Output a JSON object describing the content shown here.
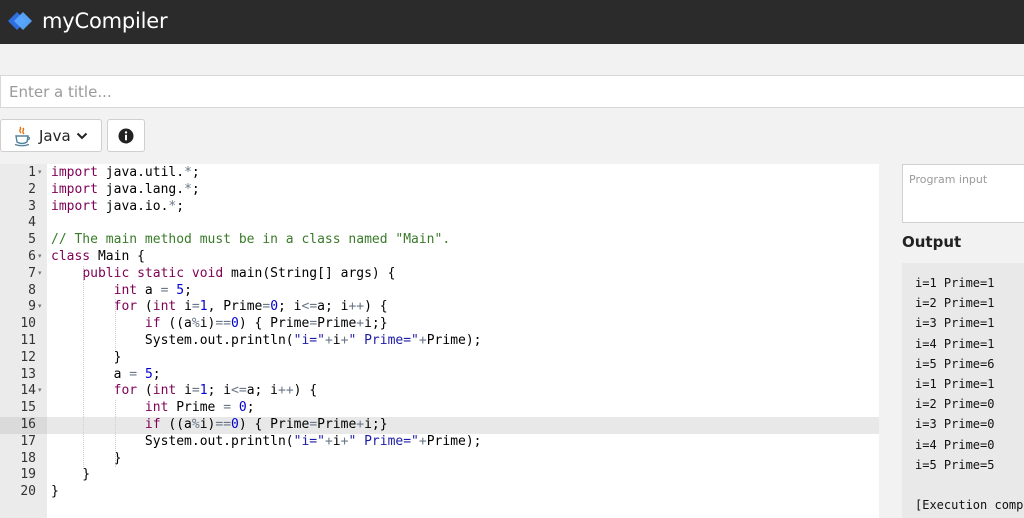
{
  "app": {
    "name": "myCompiler",
    "brand_colors": [
      "#3d7ef2",
      "#5aa8ff"
    ]
  },
  "title_input": {
    "placeholder": "Enter a title...",
    "value": ""
  },
  "language": {
    "selected": "Java",
    "icon": "java-icon"
  },
  "info_button": {
    "icon": "info-icon"
  },
  "editor": {
    "active_line": 16,
    "lines": [
      {
        "n": "1",
        "fold": true,
        "code": "<span class=\"k\">import</span> java.util.<span class=\"o\">*</span>;"
      },
      {
        "n": "2",
        "fold": false,
        "code": "<span class=\"k\">import</span> java.lang.<span class=\"o\">*</span>;"
      },
      {
        "n": "3",
        "fold": false,
        "code": "<span class=\"k\">import</span> java.io.<span class=\"o\">*</span>;"
      },
      {
        "n": "4",
        "fold": false,
        "code": ""
      },
      {
        "n": "5",
        "fold": false,
        "code": "<span class=\"c\">// The main method must be in a class named \"Main\".</span>"
      },
      {
        "n": "6",
        "fold": true,
        "code": "<span class=\"k\">class</span> Main {"
      },
      {
        "n": "7",
        "fold": true,
        "code": "    <span class=\"k\">public</span> <span class=\"k\">static</span> <span class=\"k\">void</span> main(String[] args) {"
      },
      {
        "n": "8",
        "fold": false,
        "code": "        <span class=\"t\">int</span> a <span class=\"o\">=</span> <span class=\"n\">5</span>;"
      },
      {
        "n": "9",
        "fold": true,
        "code": "        <span class=\"k\">for</span> (<span class=\"t\">int</span> i<span class=\"o\">=</span><span class=\"n\">1</span>, Prime<span class=\"o\">=</span><span class=\"n\">0</span>; i<span class=\"o\">&lt;=</span>a; i<span class=\"o\">++</span>) {"
      },
      {
        "n": "10",
        "fold": false,
        "code": "            <span class=\"k\">if</span> ((a<span class=\"o\">%</span>i)<span class=\"o\">==</span><span class=\"n\">0</span>) { Prime<span class=\"o\">=</span>Prime<span class=\"o\">+</span>i;}"
      },
      {
        "n": "11",
        "fold": false,
        "code": "            System.out.println(<span class=\"s\">\"i=\"</span><span class=\"o\">+</span>i<span class=\"o\">+</span><span class=\"s\">\" Prime=\"</span><span class=\"o\">+</span>Prime);"
      },
      {
        "n": "12",
        "fold": false,
        "code": "        }"
      },
      {
        "n": "13",
        "fold": false,
        "code": "        a <span class=\"o\">=</span> <span class=\"n\">5</span>;"
      },
      {
        "n": "14",
        "fold": true,
        "code": "        <span class=\"k\">for</span> (<span class=\"t\">int</span> i<span class=\"o\">=</span><span class=\"n\">1</span>; i<span class=\"o\">&lt;=</span>a; i<span class=\"o\">++</span>) {"
      },
      {
        "n": "15",
        "fold": false,
        "code": "            <span class=\"t\">int</span> Prime <span class=\"o\">=</span> <span class=\"n\">0</span>;"
      },
      {
        "n": "16",
        "fold": false,
        "code": "            <span class=\"k\">if</span> ((a<span class=\"o\">%</span>i)<span class=\"o\">==</span><span class=\"n\">0</span>) { Prime<span class=\"o\">=</span>Prime<span class=\"o\">+</span>i;}"
      },
      {
        "n": "17",
        "fold": false,
        "code": "            System.out.println(<span class=\"s\">\"i=\"</span><span class=\"o\">+</span>i<span class=\"o\">+</span><span class=\"s\">\" Prime=\"</span><span class=\"o\">+</span>Prime);"
      },
      {
        "n": "18",
        "fold": false,
        "code": "        }"
      },
      {
        "n": "19",
        "fold": false,
        "code": "    }"
      },
      {
        "n": "20",
        "fold": false,
        "code": "}"
      }
    ]
  },
  "program_input": {
    "placeholder": "Program input",
    "value": ""
  },
  "output": {
    "label": "Output",
    "lines": [
      "i=1 Prime=1",
      "i=2 Prime=1",
      "i=3 Prime=1",
      "i=4 Prime=1",
      "i=5 Prime=6",
      "i=1 Prime=1",
      "i=2 Prime=0",
      "i=3 Prime=0",
      "i=4 Prime=0",
      "i=5 Prime=5",
      "",
      "[Execution comp"
    ]
  }
}
